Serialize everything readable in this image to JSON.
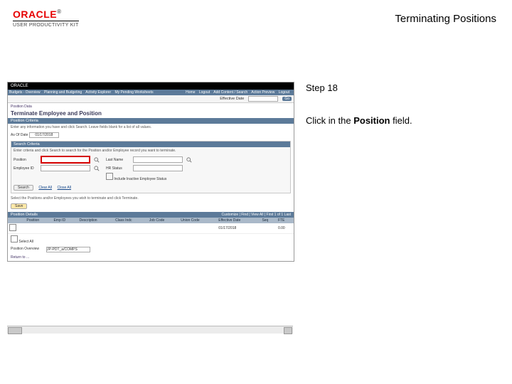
{
  "header": {
    "logo_text": "ORACLE",
    "logo_sub": "USER PRODUCTIVITY KIT",
    "page_title": "Terminating Positions"
  },
  "right": {
    "step_label": "Step 18",
    "instr_pre": "Click in the ",
    "instr_bold": "Position",
    "instr_post": " field."
  },
  "app": {
    "brand": "ORACLE",
    "nav_left": [
      "Budgets - Overview",
      "Planning and Budgeting",
      "Activity Explorer",
      "My Pending Worksheets"
    ],
    "nav_right": [
      "Home",
      "Logout",
      "Add Content / Search",
      "Action Preview",
      "Logout"
    ],
    "substrip": {
      "eff_label": "Effective Date",
      "go": "Go"
    },
    "breadcrumb": "Position Data",
    "h1": "Terminate Employee and Position",
    "bar1": "Position Criteria",
    "top_note": "Enter any information you have and click Search. Leave fields blank for a list of all values.",
    "asof": {
      "label": "As Of Date",
      "value": "01/17/2018"
    },
    "search_panel": {
      "title": "Search Criteria",
      "note": "Enter criteria and click Search to search for the Position and/or Employee record you want to terminate.",
      "labels": {
        "position": "Position",
        "lastname": "Last Name",
        "empid": "Employee ID",
        "hrstat": "HR Status",
        "hrstat_hint": "Include Inactive Employee Status"
      },
      "search_btn": "Search",
      "clear_link": "Clear All",
      "close_link": "Close All"
    },
    "sect_note": "Select the Positions and/or Employees you wish to terminate and click Terminate.",
    "save_btn": "Save",
    "bar2": {
      "title": "Position Details",
      "right": "Customize | Find | View All | First 1 of 1 Last"
    },
    "table": {
      "cols": [
        "",
        "Position",
        "Emp ID",
        "Description",
        "Class Indc",
        "Job Code",
        "Union Code",
        "Effective Date",
        "Seq",
        "FTE"
      ],
      "rows": [
        [
          "",
          "",
          "",
          "",
          "",
          "",
          "",
          "01/17/2018",
          "",
          "0.00"
        ]
      ]
    },
    "summary": {
      "sel_label": "Select All",
      "pos_ovr": "Position Overview",
      "ref": "JP-PDT_a/COMPS"
    },
    "bottom_link": "Return to ..."
  }
}
